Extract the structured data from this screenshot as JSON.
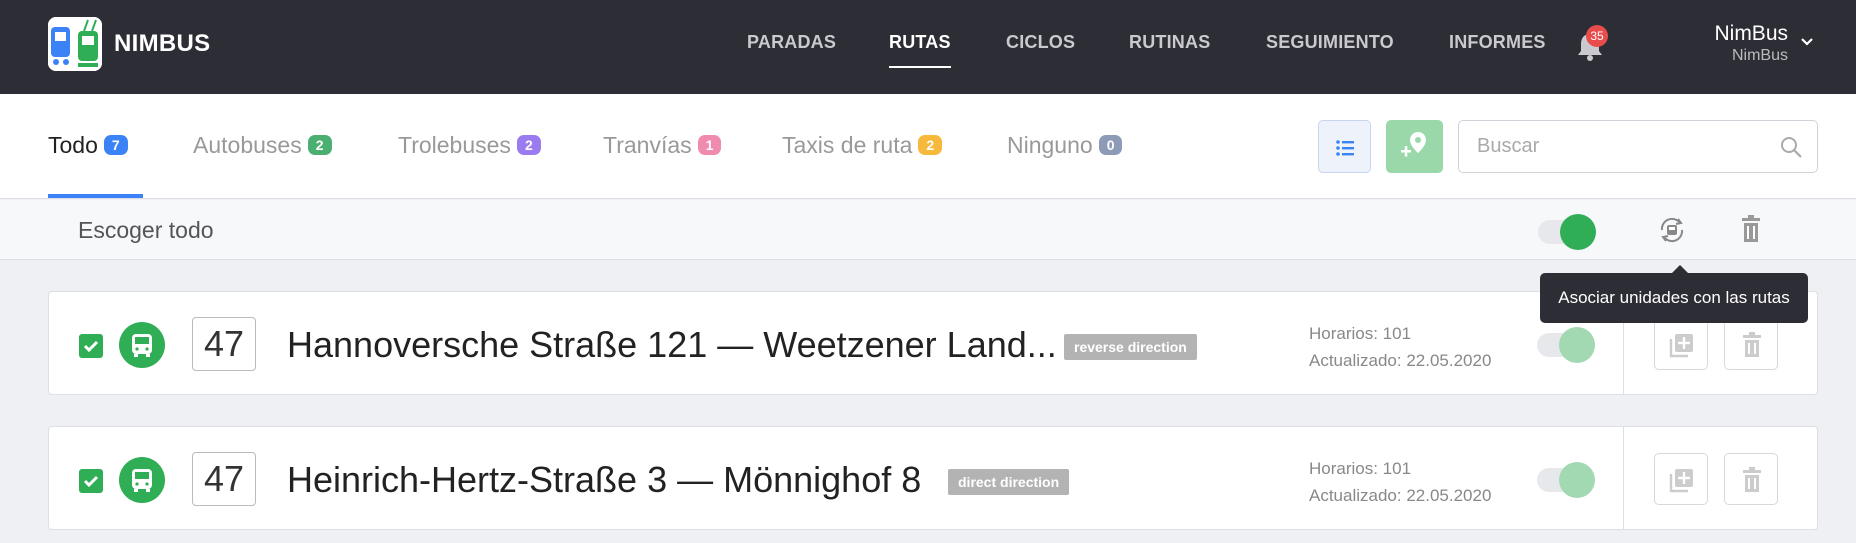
{
  "app": {
    "brand": "NIMBUS"
  },
  "nav": {
    "items": [
      "PARADAS",
      "RUTAS",
      "CICLOS",
      "RUTINAS",
      "SEGUIMIENTO",
      "INFORMES"
    ],
    "active": "RUTAS",
    "notifications_count": "35"
  },
  "user": {
    "name": "NimBus",
    "org": "NimBus"
  },
  "tabs": [
    {
      "label": "Todo",
      "count": "7",
      "color": "#3b82f6"
    },
    {
      "label": "Autobuses",
      "count": "2",
      "color": "#4caf72"
    },
    {
      "label": "Trolebuses",
      "count": "2",
      "color": "#9b7cf0"
    },
    {
      "label": "Tranvías",
      "count": "1",
      "color": "#f08bb0"
    },
    {
      "label": "Taxis de ruta",
      "count": "2",
      "color": "#f6b93b"
    },
    {
      "label": "Ninguno",
      "count": "0",
      "color": "#8e9bb6"
    }
  ],
  "search": {
    "placeholder": "Buscar",
    "value": ""
  },
  "select_all": {
    "label": "Escoger todo",
    "toggle_on": true
  },
  "tooltip": "Asociar unidades con las rutas",
  "routes": [
    {
      "number": "47",
      "title": "Hannoversche Straße 121 — Weetzener Land...",
      "direction": "reverse direction",
      "schedules": "Horarios: 101",
      "updated": "Actualizado: 22.05.2020",
      "checked": true,
      "active": true
    },
    {
      "number": "47",
      "title": "Heinrich-Hertz-Straße 3 — Mönnighof 8",
      "direction": "direct direction",
      "schedules": "Horarios: 101",
      "updated": "Actualizado: 22.05.2020",
      "checked": true,
      "active": true
    }
  ],
  "colors": {
    "accent": "#3b82f6",
    "green": "#2fae55",
    "topbar": "#2d2d35"
  }
}
